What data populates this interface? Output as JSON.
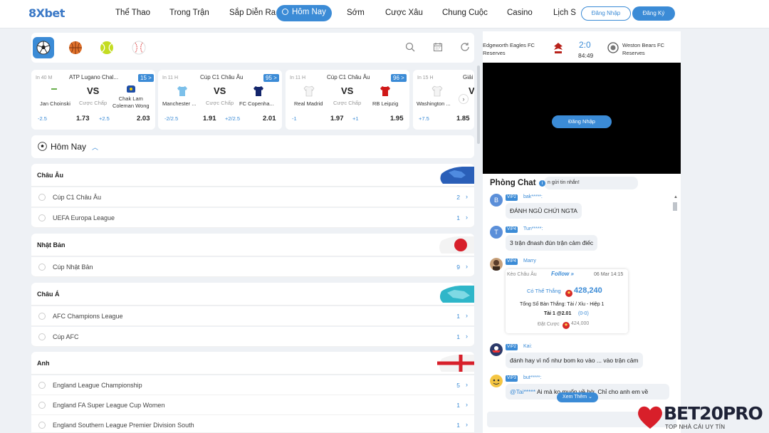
{
  "brand": {
    "logo": "8Xbet",
    "accent": "#3b8bd6"
  },
  "nav": {
    "items": [
      "Thể Thao",
      "Trong Trận",
      "Sắp Diễn Ra",
      "Hôm Nay",
      "Sớm",
      "Cược Xâu",
      "Chung Cuộc",
      "Casino",
      "Lịch S"
    ],
    "active": "Hôm Nay",
    "login": "Đăng Nhập",
    "register": "Đăng Ký"
  },
  "sports": [
    {
      "icon": "soccer-ball-icon",
      "active": true
    },
    {
      "icon": "basketball-icon",
      "active": false
    },
    {
      "icon": "tennis-ball-icon",
      "active": false
    },
    {
      "icon": "baseball-icon",
      "active": false
    }
  ],
  "tools": [
    "search-icon",
    "calendar-icon",
    "refresh-icon"
  ],
  "cards": [
    {
      "time": "In 40 M",
      "league": "ATP Lugano Chal...",
      "markets": "15 >",
      "home": "Jan Choinski",
      "away": "Chak Lam\nColeman Wong",
      "handicap": "Cược Chấp",
      "home_line": "-2.5",
      "home_odd": "1.73",
      "away_line": "+2.5",
      "away_odd": "2.03"
    },
    {
      "time": "In 11 H",
      "league": "Cúp C1 Châu Âu",
      "markets": "95 >",
      "home": "Manchester ...",
      "away": "FC Copenha...",
      "handicap": "Cược Chấp",
      "home_line": "-2/2.5",
      "home_odd": "1.91",
      "away_line": "+2/2.5",
      "away_odd": "2.01"
    },
    {
      "time": "In 11 H",
      "league": "Cúp C1 Châu Âu",
      "markets": "96 >",
      "home": "Real Madrid",
      "away": "RB Leipzig",
      "handicap": "Cược Chấp",
      "home_line": "-1",
      "home_odd": "1.97",
      "away_line": "+1",
      "away_odd": "1.95"
    },
    {
      "time": "In 15 H",
      "league": "Giải",
      "home": "Washington ...",
      "vs": "V",
      "home_line": "+7.5",
      "home_odd": "1.85"
    }
  ],
  "vs_label": "VS",
  "today": {
    "title": "Hôm Nay"
  },
  "groups": [
    {
      "name": "Châu Âu",
      "competitions": [
        {
          "name": "Cúp C1 Châu Âu",
          "count": "2"
        },
        {
          "name": "UEFA Europa League",
          "count": "1"
        }
      ]
    },
    {
      "name": "Nhật Bản",
      "competitions": [
        {
          "name": "Cúp Nhật Bản",
          "count": "9"
        }
      ]
    },
    {
      "name": "Châu Á",
      "competitions": [
        {
          "name": "AFC Champions League",
          "count": "1"
        },
        {
          "name": "Cúp AFC",
          "count": "1"
        }
      ]
    },
    {
      "name": "Anh",
      "competitions": [
        {
          "name": "England League Championship",
          "count": "5"
        },
        {
          "name": "England FA Super League Cup Women",
          "count": "1"
        },
        {
          "name": "England Southern League Premier Division South",
          "count": "1"
        }
      ]
    }
  ],
  "live": {
    "home": "Edgeworth Eagles FC\nReserves",
    "away": "Weston Bears FC\nReserves",
    "score": "2:0",
    "minute": "84:49",
    "video_login": "Đăng Nhập"
  },
  "chat": {
    "title": "Phòng Chat",
    "hint": "n gửi tin nhắn!",
    "more": "Xem Thêm",
    "messages": [
      {
        "avatar": "B",
        "vip": "VIP2",
        "user": "bak*****:",
        "text": "ĐÁNH NGỦ CHỨI NGTA"
      },
      {
        "avatar": "T",
        "vip": "VIP4",
        "user": "Tun*****:",
        "text": "3 trận đnash đún trận cảm điếc"
      },
      {
        "avatar": "",
        "vip": "VIP4",
        "user": "Marry"
      },
      {
        "avatar": "",
        "vip": "VIP2",
        "user": "Kai:",
        "text": "đánh hay vì nổ như bom ko vào ... vào trận cảm"
      },
      {
        "avatar": "",
        "vip": "VIP3",
        "user": "but*****:",
        "mention": "@Tai*****",
        "text": "Ai mà ko muốn về bờ. Chỉ cho anh em về"
      }
    ],
    "bet": {
      "market": "Kèo Châu Âu",
      "follow": "Follow »",
      "date": "06 Mar 14:15",
      "win_label": "Có Thể Thắng",
      "win_amount": "428,240",
      "desc": "Tổng Số Bàn Thắng: Tài / Xỉu - Hiệp 1",
      "pick": "Tài 1 @2.01",
      "pick_score": "(0-0)",
      "stake_label": "Đặt Cược",
      "stake": "424,000"
    }
  },
  "watermark": {
    "title": "BET20PRO",
    "subtitle": "TOP NHÀ CÁI UY TÍN"
  }
}
